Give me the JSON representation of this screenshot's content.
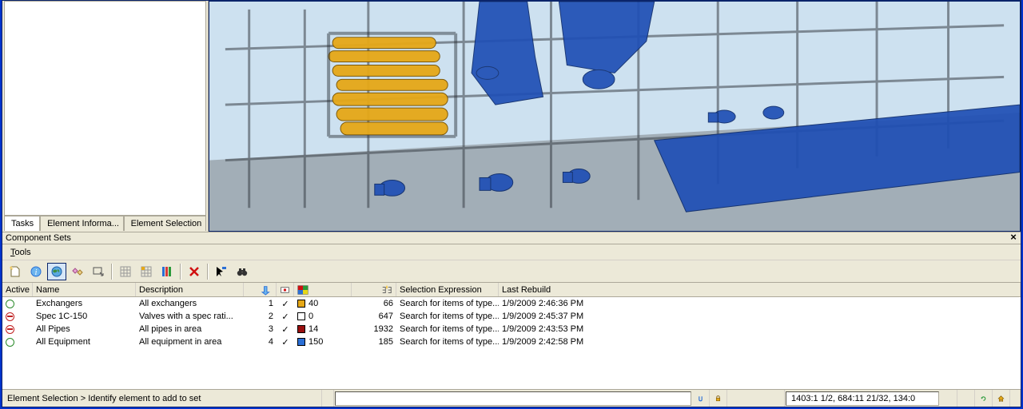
{
  "side_tabs": [
    "Tasks",
    "Element  Informa...",
    "Element Selection"
  ],
  "panel_title": "Component Sets",
  "menu": {
    "tools": "Tools"
  },
  "toolbar_icons": [
    "new-set",
    "info",
    "globe",
    "diamonds",
    "box-arrow",
    "mesh",
    "grid-hilite",
    "columns",
    "delete",
    "cursor-flag",
    "binoculars"
  ],
  "columns": {
    "active": "Active",
    "name": "Name",
    "description": "Description",
    "selection_expression": "Selection Expression",
    "last_rebuild": "Last Rebuild"
  },
  "rows": [
    {
      "active": "green",
      "name": "Exchangers",
      "description": "All exchangers",
      "num": "1",
      "check": true,
      "color": "#e6a817",
      "color_label": "40",
      "count": "66",
      "expr": "Search for items of type...",
      "rebuild": "1/9/2009 2:46:36 PM"
    },
    {
      "active": "red",
      "name": "Spec 1C-150",
      "description": "Valves with a spec rati...",
      "num": "2",
      "check": true,
      "color": "#ffffff",
      "color_label": "0",
      "count": "647",
      "expr": "Search for items of type...",
      "rebuild": "1/9/2009 2:45:37 PM"
    },
    {
      "active": "red",
      "name": "All Pipes",
      "description": "All pipes in area",
      "num": "3",
      "check": true,
      "color": "#9a0f0f",
      "color_label": "14",
      "count": "1932",
      "expr": "Search for items of type...",
      "rebuild": "1/9/2009 2:43:53 PM"
    },
    {
      "active": "green",
      "name": "All Equipment",
      "description": "All equipment in area",
      "num": "4",
      "check": true,
      "color": "#2a6fd6",
      "color_label": "150",
      "count": "185",
      "expr": "Search for items of type...",
      "rebuild": "1/9/2009 2:42:58 PM"
    }
  ],
  "status": {
    "prompt": "Element Selection > Identify element to add to set",
    "coords": "1403:1 1/2, 684:11 21/32, 134:0"
  }
}
